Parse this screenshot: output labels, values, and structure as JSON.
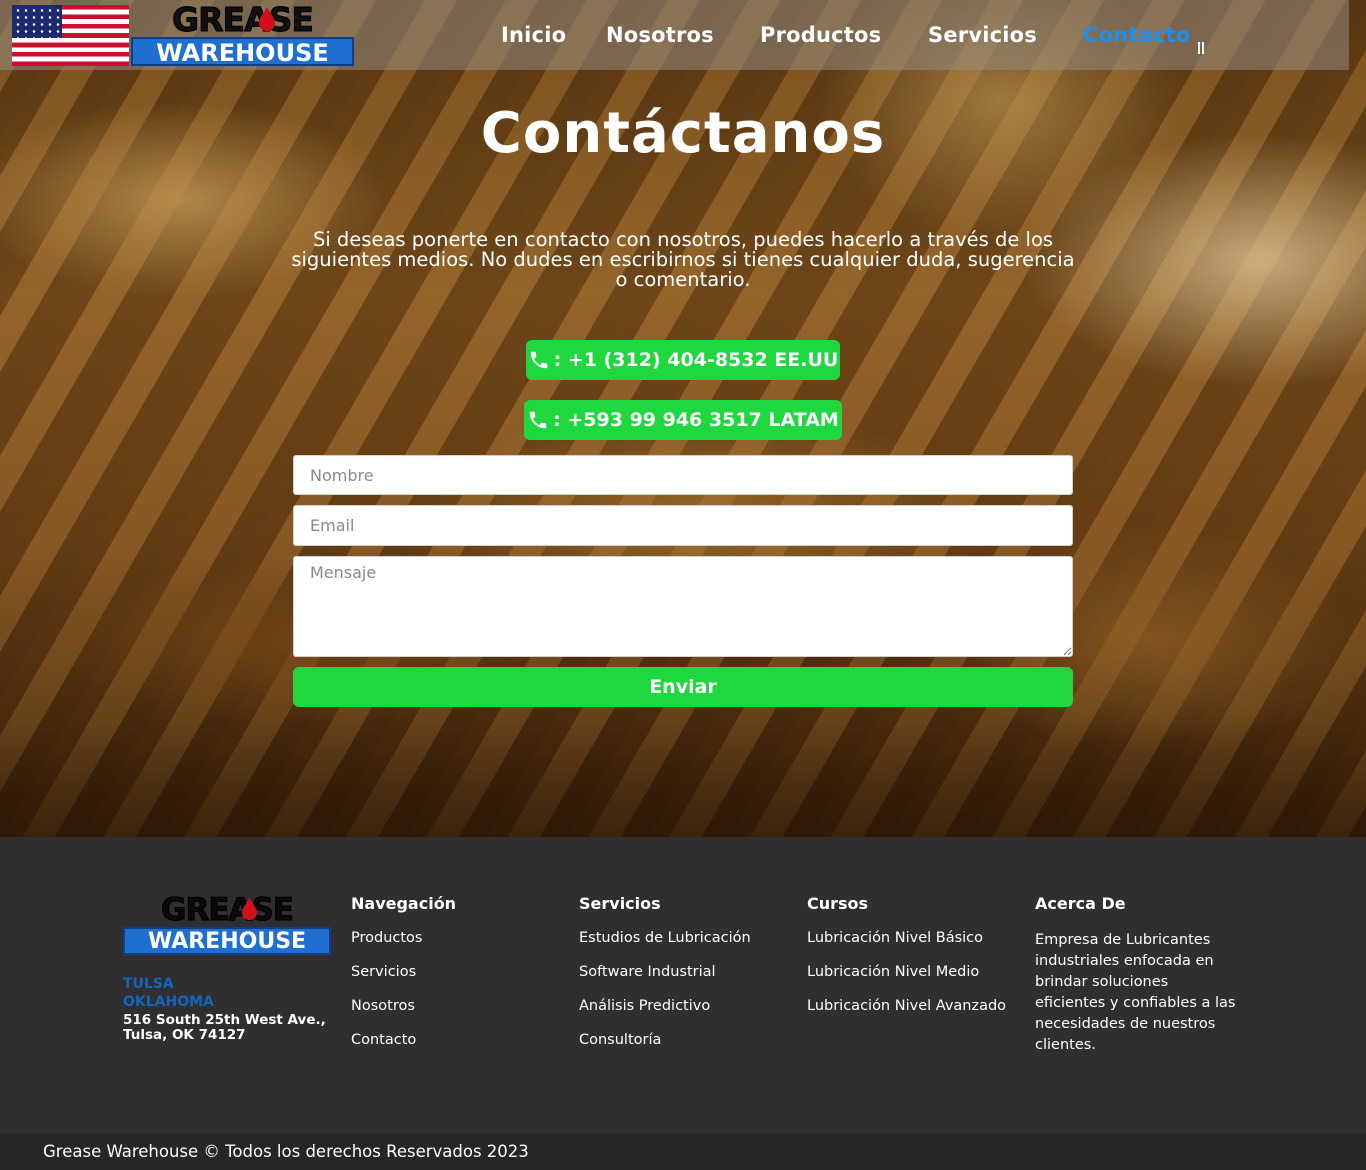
{
  "header": {
    "logo_top": "GREASE",
    "logo_bottom": "WAREHOUSE",
    "nav": [
      {
        "label": "Inicio"
      },
      {
        "label": "Nosotros"
      },
      {
        "label": "Productos"
      },
      {
        "label": "Servicios"
      },
      {
        "label": "Contacto",
        "active": true
      }
    ],
    "active_color": "#1e8ef0"
  },
  "hero": {
    "title": "Contáctanos",
    "intro": "Si deseas ponerte en contacto con nosotros, puedes hacerlo a través de los siguientes medios. No dudes en escribirnos si tienes cualquier duda, sugerencia o comentario.",
    "phones": [
      {
        "icon": "phone-icon",
        "label": ": +1 (312) 404-8532 EE.UU"
      },
      {
        "icon": "phone-icon",
        "label": ": +593 99 946 3517 LATAM"
      }
    ],
    "button_color": "#1fd73e"
  },
  "form": {
    "name_placeholder": "Nombre",
    "email_placeholder": "Email",
    "message_placeholder": "Mensaje",
    "submit_label": "Enviar"
  },
  "footer": {
    "logo_top": "GREASE",
    "logo_bottom": "WAREHOUSE",
    "city_line1": "TULSA",
    "city_line2": "OKLAHOMA",
    "address_line1": "516 South 25th West Ave.,",
    "address_line2": "Tulsa, OK 74127",
    "columns": [
      {
        "title": "Navegación",
        "items": [
          "Productos",
          "Servicios",
          "Nosotros",
          "Contacto"
        ]
      },
      {
        "title": "Servicios",
        "items": [
          "Estudios de Lubricación",
          "Software Industrial",
          "Análisis Predictivo",
          "Consultoría"
        ]
      },
      {
        "title": "Cursos",
        "items": [
          "Lubricación Nivel Básico",
          "Lubricación Nivel Medio",
          "Lubricación Nivel Avanzado"
        ]
      }
    ],
    "about_title": "Acerca De",
    "about_text": "Empresa de Lubricantes industriales enfocada en brindar soluciones eficientes y confiables a las necesidades de nuestros clientes.",
    "copyright": "Grease Warehouse © Todos los derechos Reservados 2023",
    "brand_blue": "#1f6fd1"
  }
}
